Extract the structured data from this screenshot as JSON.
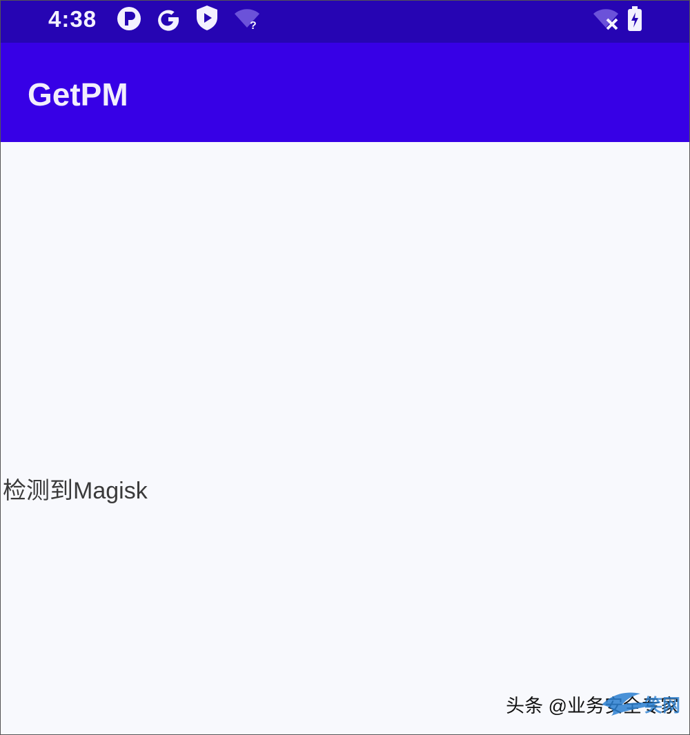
{
  "status_bar": {
    "time": "4:38",
    "icons": [
      "p-badge-icon",
      "google-g-icon",
      "shield-play-icon",
      "wifi-question-icon",
      "wifi-off-icon",
      "battery-icon"
    ]
  },
  "app_bar": {
    "title": "GetPM"
  },
  "content": {
    "result_text": "检测到Magisk"
  },
  "watermark": {
    "text": "头条 @业务安全专家"
  },
  "colors": {
    "status_bar": "#2605b3",
    "app_bar": "#3700e6",
    "background": "#f8f9fd"
  }
}
